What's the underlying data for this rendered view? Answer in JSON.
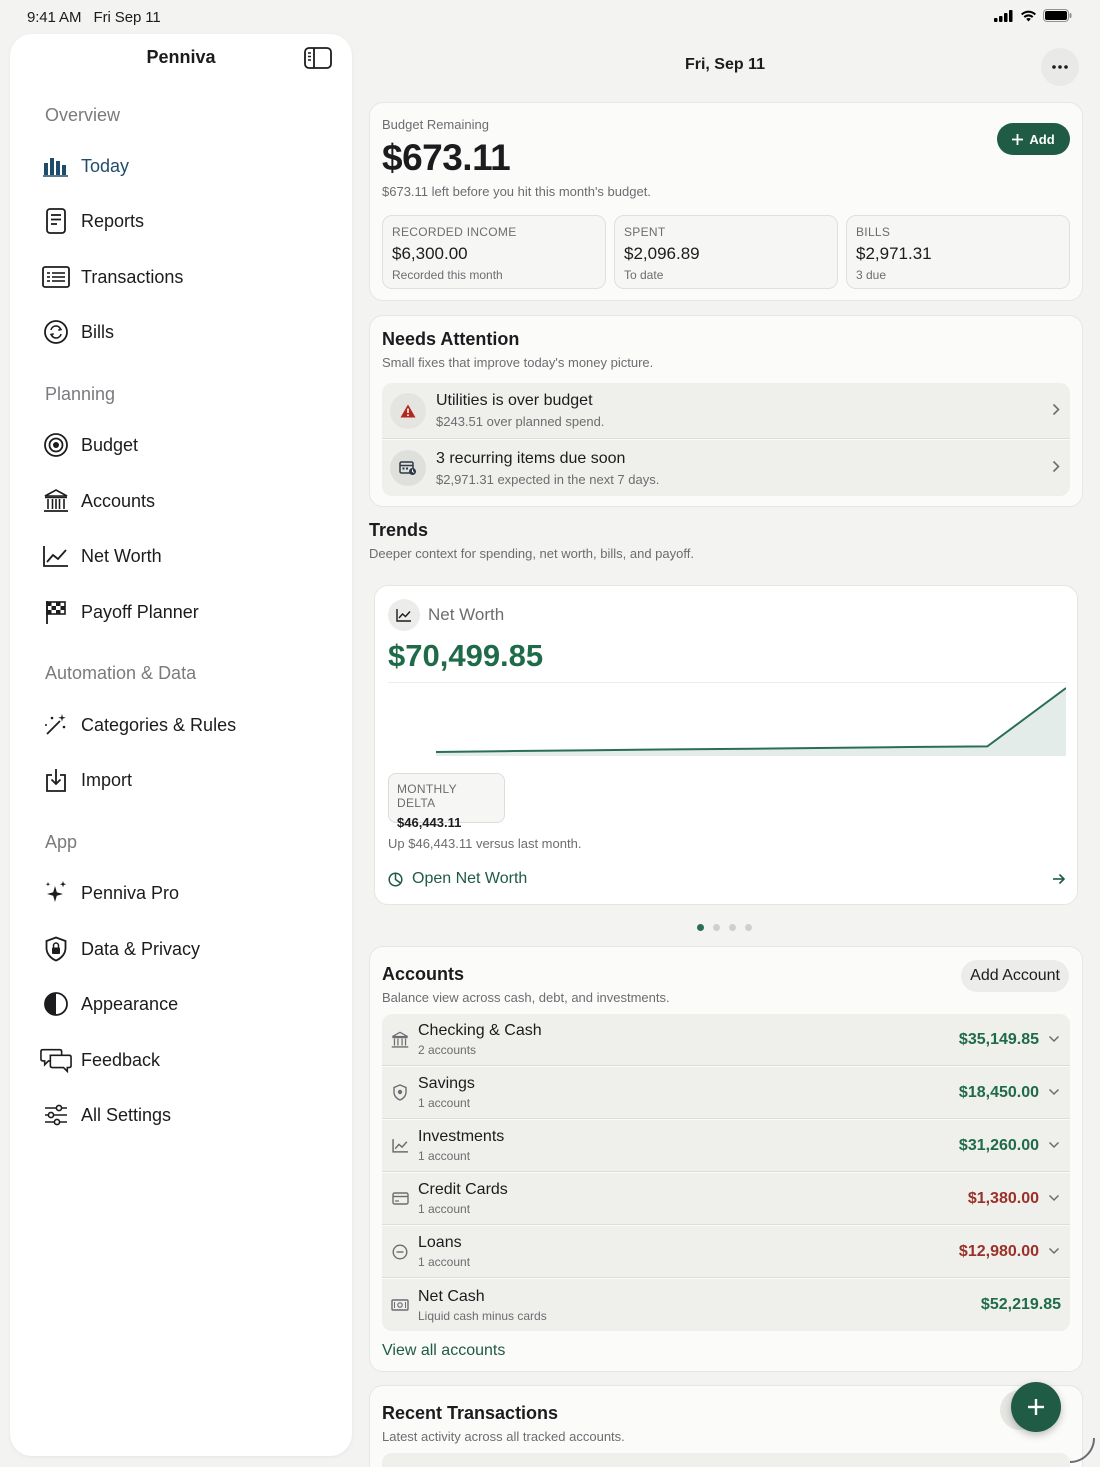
{
  "status": {
    "time": "9:41 AM",
    "date": "Fri Sep 11"
  },
  "sidebar": {
    "title": "Penniva",
    "sections": [
      {
        "label": "Overview",
        "items": [
          {
            "label": "Today",
            "icon": "chart-bar-icon"
          },
          {
            "label": "Reports",
            "icon": "document-icon"
          },
          {
            "label": "Transactions",
            "icon": "list-icon"
          },
          {
            "label": "Bills",
            "icon": "recurring-icon"
          }
        ]
      },
      {
        "label": "Planning",
        "items": [
          {
            "label": "Budget",
            "icon": "target-icon"
          },
          {
            "label": "Accounts",
            "icon": "bank-icon"
          },
          {
            "label": "Net Worth",
            "icon": "line-chart-icon"
          },
          {
            "label": "Payoff Planner",
            "icon": "flag-icon"
          }
        ]
      },
      {
        "label": "Automation & Data",
        "items": [
          {
            "label": "Categories & Rules",
            "icon": "magic-wand-icon"
          },
          {
            "label": "Import",
            "icon": "import-icon"
          }
        ]
      },
      {
        "label": "App",
        "items": [
          {
            "label": "Penniva Pro",
            "icon": "sparkles-icon"
          },
          {
            "label": "Data & Privacy",
            "icon": "lock-shield-icon"
          },
          {
            "label": "Appearance",
            "icon": "half-circle-icon"
          },
          {
            "label": "Feedback",
            "icon": "chat-bubbles-icon"
          },
          {
            "label": "All Settings",
            "icon": "sliders-icon"
          }
        ]
      }
    ]
  },
  "header": {
    "date": "Fri, Sep 11"
  },
  "budget": {
    "label": "Budget Remaining",
    "amount": "$673.11",
    "note": "$673.11 left before you hit this month's budget.",
    "add_label": "Add",
    "stats": [
      {
        "key": "RECORDED INCOME",
        "value": "$6,300.00",
        "sub": "Recorded this month"
      },
      {
        "key": "SPENT",
        "value": "$2,096.89",
        "sub": "To date"
      },
      {
        "key": "BILLS",
        "value": "$2,971.31",
        "sub": "3 due"
      }
    ]
  },
  "attention": {
    "title": "Needs Attention",
    "subtitle": "Small fixes that improve today's money picture.",
    "items": [
      {
        "title": "Utilities is over budget",
        "detail": "$243.51 over planned spend.",
        "icon": "warning-icon"
      },
      {
        "title": "3 recurring items due soon",
        "detail": "$2,971.31 expected in the next 7 days.",
        "icon": "calendar-icon"
      }
    ]
  },
  "trends": {
    "title": "Trends",
    "subtitle": "Deeper context for spending, net worth, bills, and payoff.",
    "card": {
      "label": "Net Worth",
      "amount": "$70,499.85",
      "delta_key": "MONTHLY DELTA",
      "delta_value": "$46,443.11",
      "note": "Up $46,443.11 versus last month.",
      "link": "Open Net Worth"
    },
    "page_count": 4,
    "page_active": 1
  },
  "chart_data": {
    "type": "area",
    "series": [
      {
        "values": [
          24000,
          24700,
          25300,
          25900,
          26400,
          27000,
          27600,
          28100,
          70499.85
        ]
      }
    ],
    "color": "#2b6e58",
    "grid": false
  },
  "accounts": {
    "title": "Accounts",
    "subtitle": "Balance view across cash, debt, and investments.",
    "add_label": "Add Account",
    "rows": [
      {
        "name": "Checking & Cash",
        "sub": "2 accounts",
        "amount": "$35,149.85",
        "tone": "pos",
        "icon": "bank-icon",
        "chevron": true
      },
      {
        "name": "Savings",
        "sub": "1 account",
        "amount": "$18,450.00",
        "tone": "pos",
        "icon": "shield-icon",
        "chevron": true
      },
      {
        "name": "Investments",
        "sub": "1 account",
        "amount": "$31,260.00",
        "tone": "pos",
        "icon": "line-chart-icon",
        "chevron": true
      },
      {
        "name": "Credit Cards",
        "sub": "1 account",
        "amount": "$1,380.00",
        "tone": "neg",
        "icon": "credit-card-icon",
        "chevron": true
      },
      {
        "name": "Loans",
        "sub": "1 account",
        "amount": "$12,980.00",
        "tone": "neg",
        "icon": "minus-circle-icon",
        "chevron": true
      },
      {
        "name": "Net Cash",
        "sub": "Liquid cash minus cards",
        "amount": "$52,219.85",
        "tone": "pos",
        "icon": "banknote-icon",
        "chevron": false
      }
    ],
    "view_all": "View all accounts"
  },
  "recent": {
    "title": "Recent Transactions",
    "subtitle": "Latest activity across all tracked accounts."
  },
  "colors": {
    "accent": "#1f5b45",
    "positive": "#1f6b49",
    "negative": "#9a3128",
    "warning": "#b3261e"
  }
}
